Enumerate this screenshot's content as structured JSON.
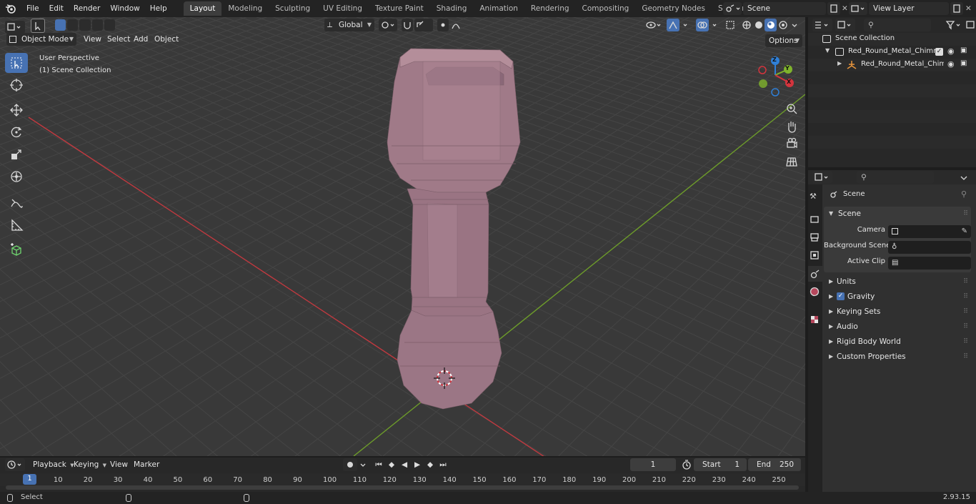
{
  "topbar": {
    "menus": [
      "File",
      "Edit",
      "Render",
      "Window",
      "Help"
    ],
    "workspaces": [
      "Layout",
      "Modeling",
      "Sculpting",
      "UV Editing",
      "Texture Paint",
      "Shading",
      "Animation",
      "Rendering",
      "Compositing",
      "Geometry Nodes",
      "Scripting"
    ],
    "active_workspace": "Layout",
    "add_tab": "+",
    "scene_name": "Scene",
    "view_layer": "View Layer"
  },
  "viewport_header": {
    "mode": "Object Mode",
    "menus": [
      "View",
      "Select",
      "Add",
      "Object"
    ],
    "transform_orientation": "Global",
    "options": "Options"
  },
  "viewport": {
    "overlay_line1": "User Perspective",
    "overlay_line2": "(1) Scene Collection",
    "gizmo": {
      "x": "X",
      "y": "Y",
      "z": "Z"
    }
  },
  "tools": [
    "select-box-icon",
    "cursor-icon",
    "move-icon",
    "rotate-icon",
    "scale-icon",
    "transform-icon",
    "annotate-icon",
    "measure-icon",
    "add-cube-icon"
  ],
  "outliner": {
    "root": "Scene Collection",
    "collection": "Red_Round_Metal_Chimney_",
    "object": "Red_Round_Metal_Chimi"
  },
  "properties": {
    "context": "Scene",
    "section": "Scene",
    "camera_label": "Camera",
    "background_scene_label": "Background Scene",
    "active_clip_label": "Active Clip",
    "panels": [
      "Units",
      "Gravity",
      "Keying Sets",
      "Audio",
      "Rigid Body World",
      "Custom Properties"
    ],
    "gravity_checked": true
  },
  "timeline": {
    "menus": [
      "Playback",
      "Keying",
      "View",
      "Marker"
    ],
    "current_frame": "1",
    "start_label": "Start",
    "start_value": "1",
    "end_label": "End",
    "end_value": "250",
    "ticks": [
      "1",
      "10",
      "20",
      "30",
      "40",
      "50",
      "60",
      "70",
      "80",
      "90",
      "100",
      "110",
      "120",
      "130",
      "140",
      "150",
      "160",
      "170",
      "180",
      "190",
      "200",
      "210",
      "220",
      "230",
      "240",
      "250"
    ]
  },
  "statusbar": {
    "left": "Select",
    "version": "2.93.15"
  },
  "colors": {
    "accent": "#4772b3",
    "x_axis": "#c0393f",
    "y_axis": "#6d9c2a",
    "mesh": "#a47d8a"
  }
}
